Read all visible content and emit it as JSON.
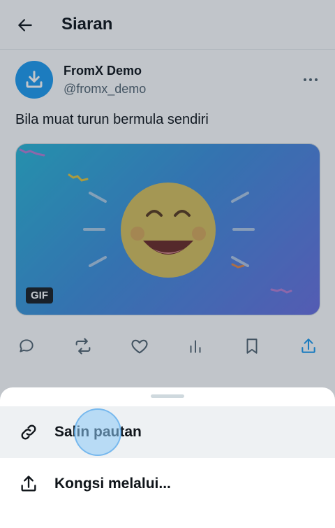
{
  "header": {
    "title": "Siaran",
    "back_icon": "arrow-left-icon"
  },
  "post": {
    "author_name": "FromX Demo",
    "author_handle": "@fromx_demo",
    "text": "Bila muat turun bermula sendiri",
    "media_badge": "GIF",
    "media_description_icon": "laughing-emoji"
  },
  "actions": [
    "reply-icon",
    "repost-icon",
    "like-icon",
    "views-icon",
    "bookmark-icon",
    "share-icon"
  ],
  "sheet": {
    "items": [
      {
        "label": "Salin pautan",
        "icon": "link-icon"
      },
      {
        "label": "Kongsi melalui...",
        "icon": "share-icon"
      }
    ]
  },
  "colors": {
    "accent": "#1d9bf0",
    "text": "#0f1419",
    "secondary_text": "#536471",
    "highlight_row": "#eef1f3"
  }
}
